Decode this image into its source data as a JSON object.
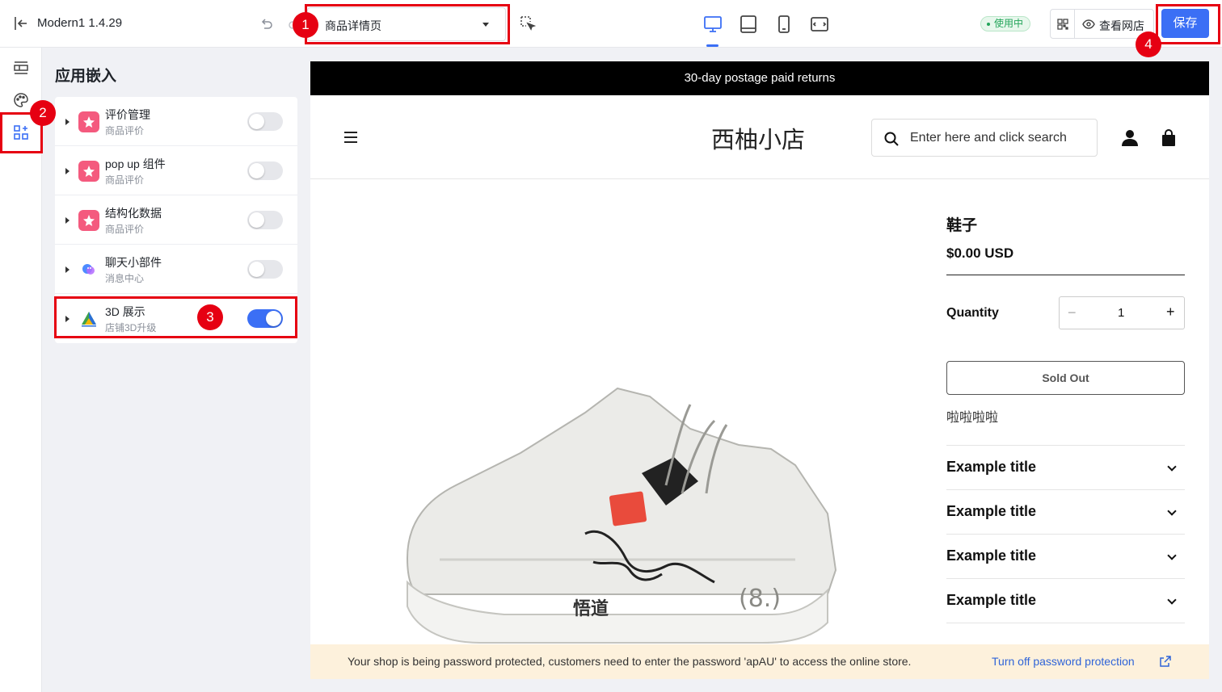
{
  "topbar": {
    "theme_title": "Modern1 1.4.29",
    "page_select": "商品详情页",
    "status": "使用中",
    "view_store": "查看网店",
    "save": "保存"
  },
  "panel": {
    "title": "应用嵌入",
    "apps": [
      {
        "name": "评价管理",
        "sub": "商品评价",
        "enabled": false
      },
      {
        "name": "pop up 组件",
        "sub": "商品评价",
        "enabled": false
      },
      {
        "name": "结构化数据",
        "sub": "商品评价",
        "enabled": false
      },
      {
        "name": "聊天小部件",
        "sub": "消息中心",
        "enabled": false
      },
      {
        "name": "3D 展示",
        "sub": "店铺3D升级",
        "enabled": true
      }
    ]
  },
  "preview": {
    "announcement": "30-day postage paid returns",
    "store_name": "西柚小店",
    "search_placeholder": "Enter here and click search",
    "product": {
      "title": "鞋子",
      "price": "$0.00 USD",
      "quantity_label": "Quantity",
      "quantity": "1",
      "minus": "−",
      "plus": "+",
      "sold_out": "Sold Out",
      "description": "啦啦啦啦",
      "accordions": [
        "Example title",
        "Example title",
        "Example title",
        "Example title"
      ]
    },
    "password_banner": {
      "message": "Your shop is being password protected, customers need to enter the password 'apAU' to access the online store.",
      "link": "Turn off password protection"
    }
  },
  "markers": [
    "1",
    "2",
    "3",
    "4"
  ],
  "colors": {
    "primary": "#3b6ff5",
    "highlight": "#e60012",
    "status_green": "#23a55a",
    "banner": "#fdf1dc"
  }
}
